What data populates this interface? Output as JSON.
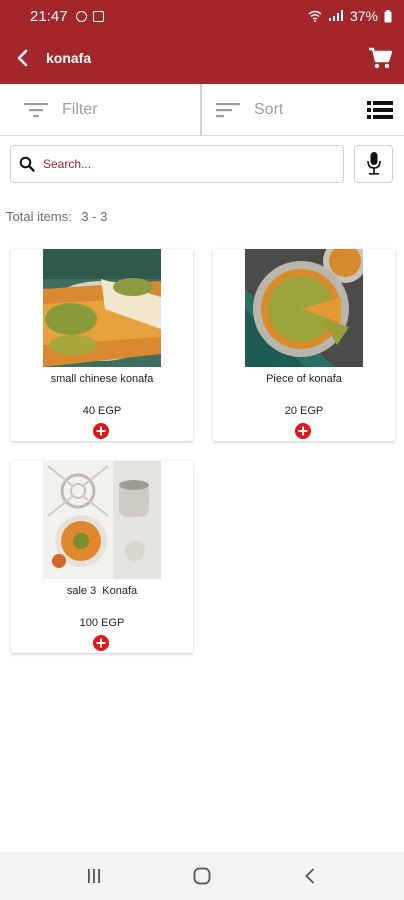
{
  "status_bar": {
    "time": "21:47",
    "battery": "37%"
  },
  "app_bar": {
    "title": "konafa"
  },
  "toolbar": {
    "filter_label": "Filter",
    "sort_label": "Sort"
  },
  "search": {
    "placeholder": "Search..."
  },
  "summary": {
    "label": "Total items:",
    "range": "3 - 3"
  },
  "products": [
    {
      "name": "small chinese konafa",
      "price": "40 EGP"
    },
    {
      "name": "Piece of konafa",
      "price": "20 EGP"
    },
    {
      "name": "sale 3  Konafa",
      "price": "100 EGP"
    }
  ],
  "colors": {
    "brand": "#a3262b",
    "add_button": "#e2151b",
    "muted_text": "#9e9e9e"
  },
  "icons": {
    "back": "chevron-left-icon",
    "cart": "cart-icon",
    "filter": "filter-icon",
    "sort": "sort-icon",
    "view": "list-view-icon",
    "search": "search-icon",
    "mic": "microphone-icon",
    "add": "add-icon"
  }
}
